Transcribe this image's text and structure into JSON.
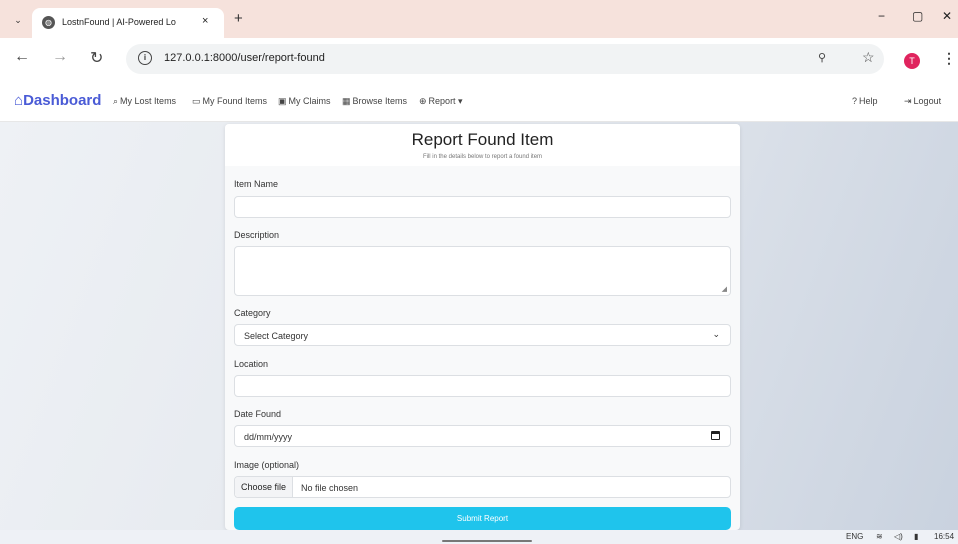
{
  "browser": {
    "tab_menu_icon": "chevron-down-icon",
    "tab_title": "LostnFound | AI-Powered Lo",
    "tab_close": "×",
    "new_tab": "+",
    "minimize": "−",
    "restore": "▢",
    "close": "✕",
    "url": "127.0.0.1:8000/user/report-found",
    "profile_initial": "T"
  },
  "nav": {
    "brand": "Dashboard",
    "links": [
      {
        "icon": "⌕",
        "label": "My Lost Items"
      },
      {
        "icon": "▭",
        "label": "My Found Items"
      },
      {
        "icon": "▣",
        "label": "My Claims"
      },
      {
        "icon": "▦",
        "label": "Browse Items"
      },
      {
        "icon": "⊕",
        "label": "Report ▾"
      }
    ],
    "help": "Help",
    "logout": "Logout"
  },
  "form": {
    "title": "Report Found Item",
    "subtitle": "Fill in the details below to report a found item",
    "item_name_label": "Item Name",
    "item_name_value": "",
    "description_label": "Description",
    "description_value": "",
    "category_label": "Category",
    "category_value": "Select Category",
    "location_label": "Location",
    "location_value": "",
    "date_label": "Date Found",
    "date_placeholder": "dd/mm/yyyy",
    "image_label": "Image (optional)",
    "choose_file": "Choose file",
    "file_status": "No file chosen",
    "submit": "Submit Report"
  },
  "taskbar": {
    "lang": "ENG",
    "time": "16:54"
  }
}
